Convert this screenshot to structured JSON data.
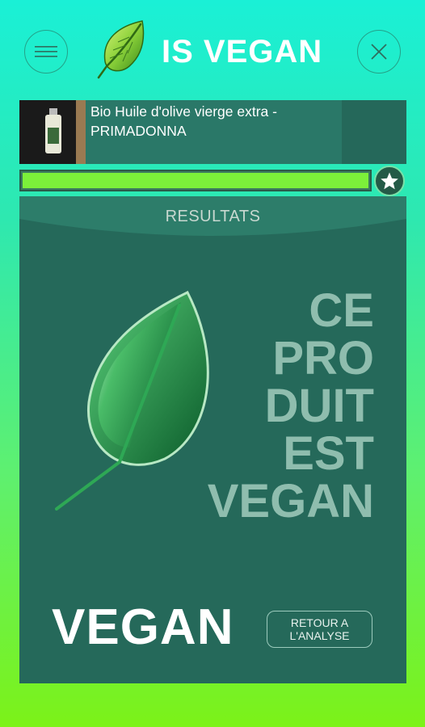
{
  "header": {
    "title": "IS VEGAN",
    "menu_icon": "hamburger-menu-icon",
    "close_icon": "close-icon",
    "logo_icon": "leaf-icon"
  },
  "product": {
    "name_line1": "Bio Huile d'olive vierge extra -",
    "name_line2": "PRIMADONNA"
  },
  "progress": {
    "value": 1.0,
    "favorite_icon": "star-icon"
  },
  "results": {
    "title": "RESULTATS",
    "verdict_lines": [
      "CE",
      "PRO",
      "DUIT",
      "EST",
      "VEGAN"
    ],
    "vegan_label": "VEGAN",
    "back_button_line1": "RETOUR A",
    "back_button_line2": "L'ANALYSE"
  },
  "colors": {
    "panel": "#25695a",
    "accent_green": "#7cf03a",
    "verdict_text": "#8fbdae"
  }
}
